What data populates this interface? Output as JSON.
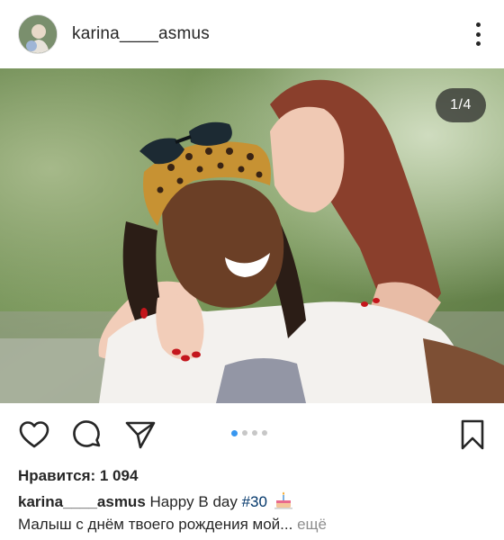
{
  "post": {
    "username": "karina____asmus",
    "avatar_icon": "profile-avatar",
    "more_icon": "more-vertical-icon"
  },
  "photo": {
    "counter": "1/4",
    "alt_subject": "couple-photo"
  },
  "actions": {
    "like_icon": "heart-icon",
    "comment_icon": "comment-icon",
    "share_icon": "paper-plane-icon",
    "save_icon": "bookmark-icon",
    "carousel_total": 4,
    "carousel_active": 1
  },
  "likes": {
    "text": "Нравится: 1 094"
  },
  "caption": {
    "username": "karina____asmus",
    "text_before": "Happy B day ",
    "hashtag": "#30",
    "emoji_icon": "birthday-cake-icon",
    "line2": "Малыш с днём твоего рождения мой...",
    "more_label": "ещё"
  },
  "colors": {
    "text": "#262626",
    "link": "#003569",
    "muted": "#8e8e8e",
    "carousel_active": "#3897f0",
    "carousel_inactive": "#c7c7c7"
  }
}
